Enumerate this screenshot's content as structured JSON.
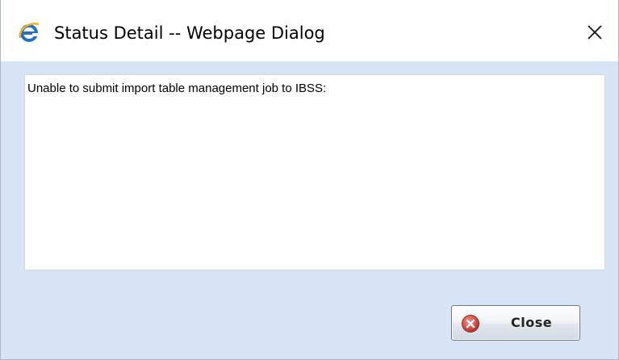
{
  "dialog": {
    "title": "Status Detail -- Webpage Dialog",
    "title_icon": "ie-icon",
    "close_icon": "close-icon"
  },
  "content": {
    "message": "Unable to submit import table management job to IBSS:"
  },
  "footer": {
    "close_button_label": "Close",
    "close_button_icon": "error-icon"
  },
  "colors": {
    "window_background": "#d6e4f5",
    "titlebar_background": "#ffffff",
    "panel_background": "#ffffff",
    "icon_red": "#d9534f"
  }
}
